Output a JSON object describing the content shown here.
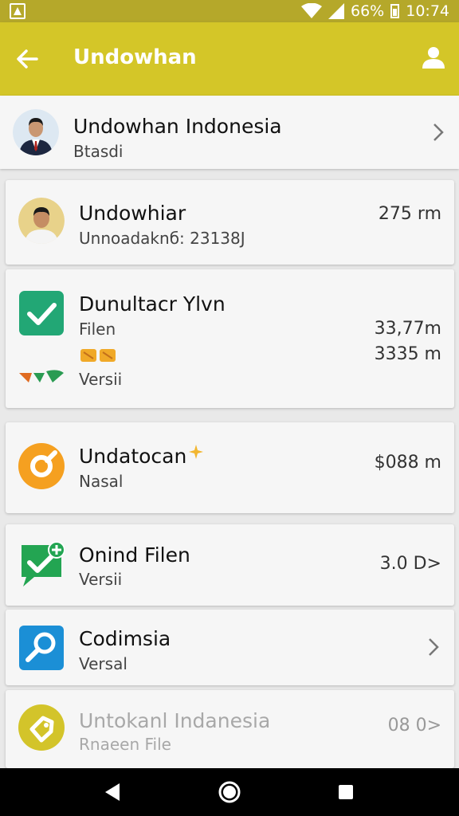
{
  "status_bar": {
    "battery_percent": "66%",
    "time": "10:74",
    "icons": [
      "notification-icon",
      "wifi-icon",
      "signal-icon",
      "battery-icon"
    ]
  },
  "app_bar": {
    "title": "Undowhan",
    "back_icon": "arrow-back-icon",
    "account_icon": "person-icon",
    "color": "#d4c628"
  },
  "list": {
    "items": [
      {
        "title": "Undowhan Indonesia",
        "subtitle": "Btasdi",
        "meta": "",
        "icon": "avatar-man-suit-icon"
      },
      {
        "title": "Undowhiar",
        "subtitle": "Unnoadaknб: 23138J",
        "meta": "275 rm",
        "icon": "avatar-man-icon"
      },
      {
        "title": "Dunultacr Ylvn",
        "subtitle": "Filen",
        "subtitle2": "Versii",
        "meta": "33,77m",
        "meta2": "3335 m",
        "icon": "green-check-icon"
      },
      {
        "title": "Undatocan",
        "subtitle": "Nasal",
        "meta": "$088 m",
        "icon": "orange-circle-icon"
      },
      {
        "title": "Onind Filen",
        "subtitle": "Versii",
        "meta": "3.0 D>",
        "icon": "green-chat-check-icon"
      },
      {
        "title": "Codimsia",
        "subtitle": "Versal",
        "meta": "",
        "icon": "blue-search-icon"
      },
      {
        "title": "Untokanl Indanesia",
        "subtitle": "Rnaeen File",
        "meta": "08 0>",
        "icon": "yellow-tag-icon"
      }
    ]
  },
  "nav_bar": {
    "icons": [
      "back-triangle-icon",
      "home-circle-icon",
      "recents-square-icon"
    ]
  }
}
